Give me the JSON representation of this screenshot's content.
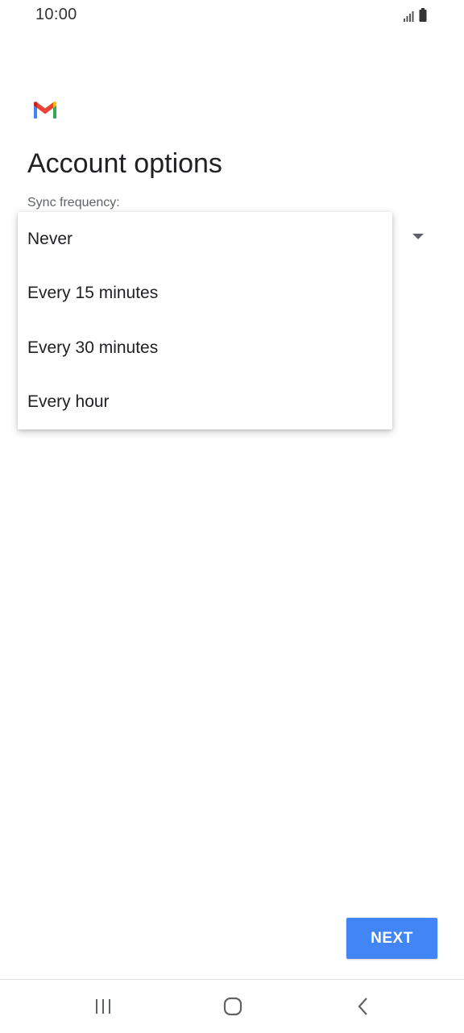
{
  "status_bar": {
    "time": "10:00",
    "signal_icon": "signal-icon",
    "battery_icon": "battery-icon"
  },
  "app": {
    "logo_icon": "gmail-logo-icon",
    "colors": {
      "red": "#ea4335",
      "blue": "#4285f4",
      "green": "#34a853",
      "yellow": "#fbbc04"
    }
  },
  "main": {
    "title": "Account options",
    "sync_label": "Sync frequency:",
    "dropdown_icon": "dropdown-arrow-icon",
    "sync_options": [
      {
        "label": "Never"
      },
      {
        "label": "Every 15 minutes"
      },
      {
        "label": "Every 30 minutes"
      },
      {
        "label": "Every hour"
      }
    ]
  },
  "footer": {
    "next_label": "NEXT",
    "accent_color": "#4285f4"
  },
  "nav_bar": {
    "recents_icon": "recents-icon",
    "home_icon": "home-icon",
    "back_icon": "back-icon"
  }
}
